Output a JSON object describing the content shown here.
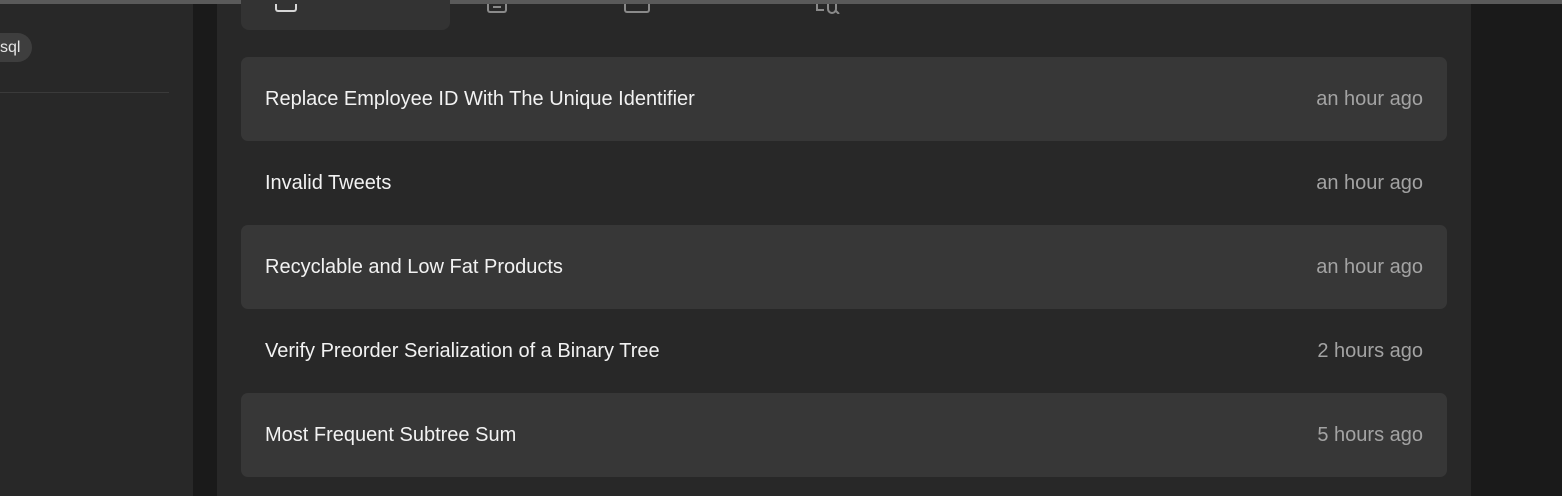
{
  "sidebar": {
    "tag_label": "sql"
  },
  "tabs": {
    "icons": [
      "list-icon",
      "note-icon",
      "code-box-icon",
      "search-icon"
    ]
  },
  "submissions": [
    {
      "title": "Replace Employee ID With The Unique Identifier",
      "time": "an hour ago"
    },
    {
      "title": "Invalid Tweets",
      "time": "an hour ago"
    },
    {
      "title": "Recyclable and Low Fat Products",
      "time": "an hour ago"
    },
    {
      "title": "Verify Preorder Serialization of a Binary Tree",
      "time": "2 hours ago"
    },
    {
      "title": "Most Frequent Subtree Sum",
      "time": "5 hours ago"
    }
  ],
  "colors": {
    "background": "#1a1a1a",
    "panel": "#282828",
    "row_alt": "#373737",
    "text_primary": "#f2f2f2",
    "text_secondary": "#a3a3a3"
  }
}
